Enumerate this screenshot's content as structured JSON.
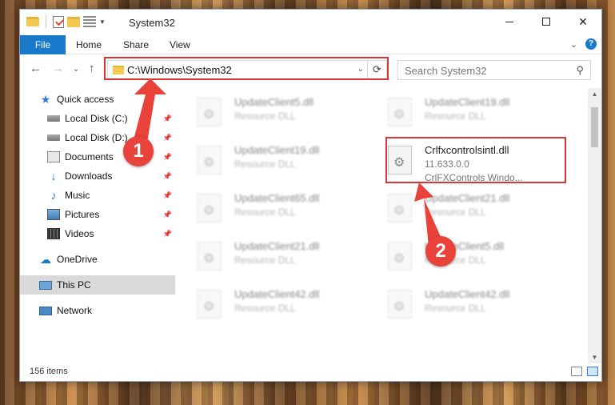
{
  "window": {
    "title": "System32",
    "controls": {
      "minimize": "minimize-icon",
      "maximize": "maximize-icon",
      "close": "✕"
    }
  },
  "ribbon": {
    "tabs": [
      "File",
      "Home",
      "Share",
      "View"
    ],
    "collapse_glyph": "⌄",
    "help_glyph": "?"
  },
  "nav": {
    "back": "←",
    "forward": "→",
    "recent": "⌄",
    "up": "↑",
    "address": "C:\\Windows\\System32",
    "address_dropdown": "⌄",
    "refresh": "⟳",
    "search_placeholder": "Search System32",
    "search_glyph": "⚲"
  },
  "sidebar": {
    "items": [
      {
        "label": "Quick access",
        "icon": "star-icon",
        "glyph": "★"
      },
      {
        "label": "Local Disk (C:)",
        "icon": "disk-icon"
      },
      {
        "label": "Local Disk (D:)",
        "icon": "disk-icon"
      },
      {
        "label": "Documents",
        "icon": "documents-icon"
      },
      {
        "label": "Downloads",
        "icon": "download-icon",
        "glyph": "↓"
      },
      {
        "label": "Music",
        "icon": "music-icon",
        "glyph": "♪"
      },
      {
        "label": "Pictures",
        "icon": "pictures-icon"
      },
      {
        "label": "Videos",
        "icon": "videos-icon"
      },
      {
        "label": "OneDrive",
        "icon": "cloud-icon",
        "glyph": "☁"
      },
      {
        "label": "This PC",
        "icon": "pc-icon"
      },
      {
        "label": "Network",
        "icon": "network-icon"
      }
    ],
    "pin_glyph": "📌"
  },
  "files": {
    "left_column": [
      {
        "name": "UpdateClient5.dll",
        "type": "Resource DLL"
      },
      {
        "name": "UpdateClient19.dll",
        "type": "Resource DLL"
      },
      {
        "name": "UpdateClient65.dll",
        "type": "Resource DLL"
      },
      {
        "name": "UpdateClient21.dll",
        "type": "Resource DLL"
      },
      {
        "name": "UpdateClient42.dll",
        "type": "Resource DLL"
      }
    ],
    "right_column": [
      {
        "name": "UpdateClient19.dll",
        "type": "Resource DLL"
      },
      {
        "name": "UpdateClient21.dll",
        "type": "Resource DLL"
      },
      {
        "name": "UpdateClient5.dll",
        "type": "Resource DLL"
      },
      {
        "name": "UpdateClient42.dll",
        "type": "Resource DLL"
      }
    ],
    "highlighted": {
      "name": "Crlfxcontrolsintl.dll",
      "version": "11.633.0.0",
      "description": "CrlFXControls Windo..."
    }
  },
  "status": {
    "item_count": "156 items"
  },
  "scroll": {
    "up": "▲",
    "down": "▼"
  },
  "annotations": {
    "step1": "1",
    "step2": "2",
    "color": "#d9372f"
  }
}
